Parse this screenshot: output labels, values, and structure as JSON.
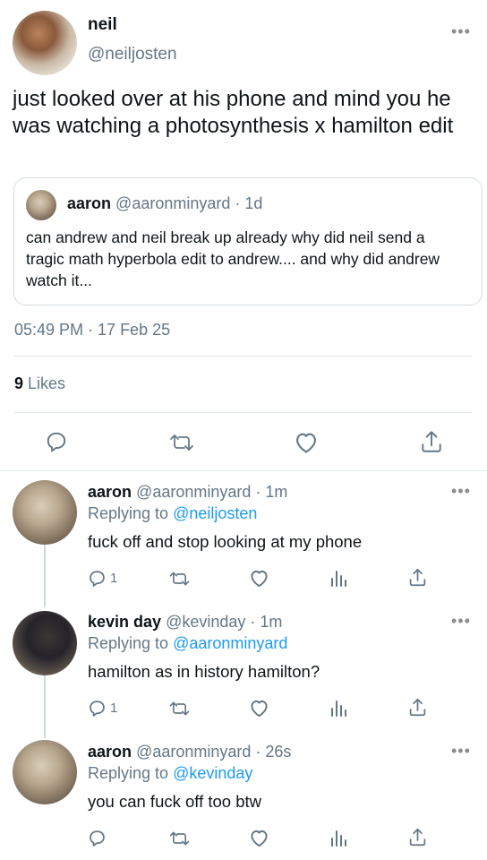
{
  "main_tweet": {
    "display_name": "neil",
    "handle": "@neiljosten",
    "text": "just looked over at his phone and mind you he was watching a photosynthesis x hamilton edit",
    "quote": {
      "display_name": "aaron",
      "handle": "@aaronminyard",
      "time": "· 1d",
      "text": "can andrew and neil break up already why did neil send a tragic math hyperbola edit to andrew.... and why did andrew watch it..."
    },
    "timestamp": "05:49 PM · 17 Feb 25",
    "likes_count": "9",
    "likes_label": "Likes"
  },
  "replies": [
    {
      "display_name": "aaron",
      "handle": "@aaronminyard",
      "time": "· 1m",
      "replying_prefix": "Replying to",
      "replying_to": "@neiljosten",
      "text": "fuck off and stop looking at my phone",
      "reply_count": "1"
    },
    {
      "display_name": "kevin day",
      "handle": "@kevinday",
      "time": "· 1m",
      "replying_prefix": "Replying to",
      "replying_to": "@aaronminyard",
      "text": "hamilton as in history hamilton?",
      "reply_count": "1"
    },
    {
      "display_name": "aaron",
      "handle": "@aaronminyard",
      "time": "· 26s",
      "replying_prefix": "Replying to",
      "replying_to": "@kevinday",
      "text": "you can fuck off too btw",
      "reply_count": ""
    }
  ],
  "icons": {
    "reply": "speech-bubble-icon",
    "retweet": "retweet-icon",
    "like": "heart-icon",
    "stats": "bar-chart-icon",
    "share": "share-icon",
    "more": "more-dots-icon"
  },
  "colors": {
    "text": "#0f1419",
    "secondary": "#657786",
    "link": "#1d9bf0",
    "divider": "#e1e8ed"
  }
}
